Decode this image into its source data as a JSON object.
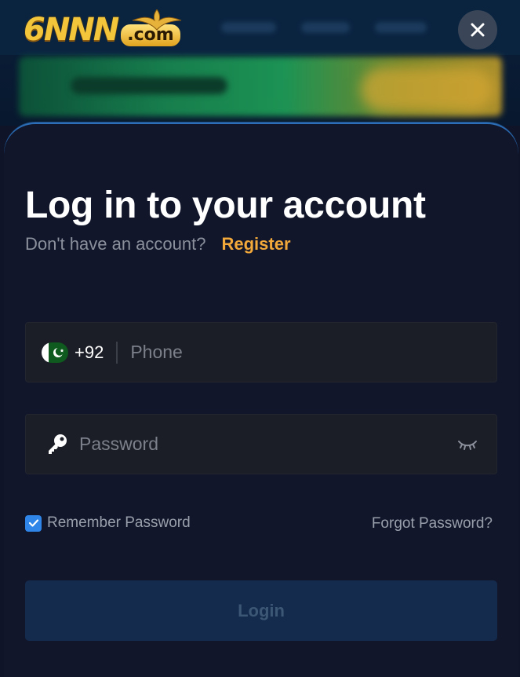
{
  "header": {
    "logo_text": "6NNN",
    "logo_suffix": ".com"
  },
  "login": {
    "title": "Log in to your account",
    "no_account_text": "Don't have an account?",
    "register_label": "Register",
    "phone": {
      "country_code": "+92",
      "placeholder": "Phone",
      "value": ""
    },
    "password": {
      "placeholder": "Password",
      "value": ""
    },
    "remember_label": "Remember Password",
    "remember_checked": true,
    "forgot_label": "Forgot Password?",
    "submit_label": "Login"
  },
  "icons": {
    "close": "close-icon",
    "flag": "pakistan-flag-icon",
    "key": "key-icon",
    "eye": "eye-closed-icon",
    "check": "check-icon"
  },
  "colors": {
    "accent": "#f3a83a",
    "checkbox": "#2f86e8",
    "sheet_bg": "#11162b",
    "field_bg": "#1b1e26",
    "button_bg": "#142b4d"
  }
}
